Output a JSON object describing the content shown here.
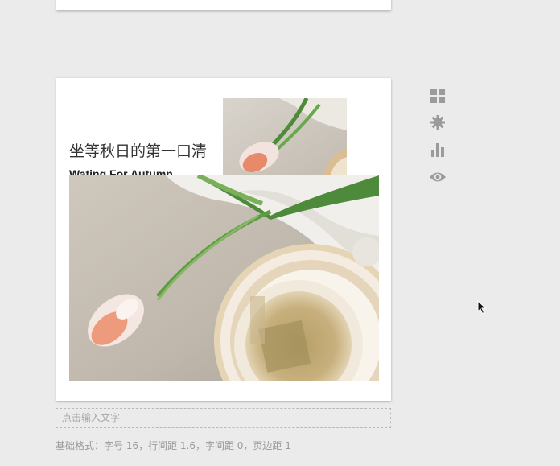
{
  "card": {
    "title_cn": "坐等秋日的第一口清",
    "title_en": "Wating For Autumn"
  },
  "images": {
    "small_photo": "tulip-and-tea-photo",
    "large_photo": "tulip-and-tea-photo"
  },
  "editor": {
    "input_placeholder": "点击输入文字",
    "format_hint": "基础格式：字号 16，行间距 1.6，字间距 0，页边距 1"
  },
  "toolbar": {
    "items": [
      {
        "icon": "grid-icon"
      },
      {
        "icon": "gear-icon"
      },
      {
        "icon": "bar-chart-icon"
      },
      {
        "icon": "eye-icon"
      }
    ]
  },
  "colors": {
    "background": "#ebebeb",
    "card": "#ffffff",
    "icon": "#9b9b9b"
  }
}
